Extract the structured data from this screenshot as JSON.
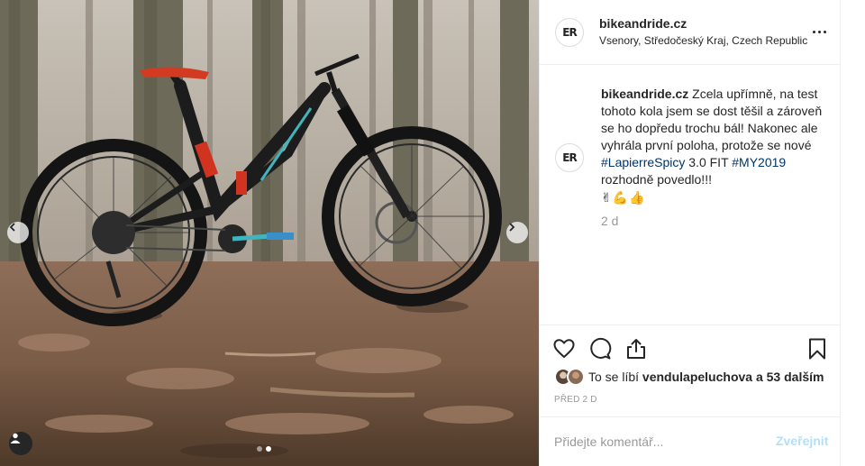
{
  "post": {
    "account": {
      "username": "bikeandride.cz",
      "location": "Vsenory, Středočeský Kraj, Czech Republic",
      "avatar_initials": "ER"
    },
    "caption": {
      "username": "bikeandride.cz",
      "text_1": " Zcela upřímně, na test tohoto kola jsem se dost těšil a zároveň se ho dopředu trochu bál! Nakonec ale vyhrála první poloha, protože se nové ",
      "hashtag_1": "#LapierreSpicy",
      "text_2": " 3.0 FIT ",
      "hashtag_2": "#MY2019",
      "text_3": " rozhodně povedlo!!!",
      "emojis": [
        "✌",
        "💪",
        "👍"
      ],
      "time_ago": "2 d"
    },
    "likes": {
      "prefix": "To se líbí ",
      "liker": "vendulapeluchova",
      "suffix": " a 53 dalším"
    },
    "posted_date": "PŘED 2 D",
    "comment": {
      "placeholder": "Přidejte komentář...",
      "publish_label": "Zveřejnit"
    }
  },
  "carousel": {
    "total": 2,
    "current": 1
  },
  "colors": {
    "link": "#003569",
    "muted": "#999999",
    "publish_disabled": "#b2dffc",
    "border": "#efefef"
  },
  "icons": {
    "prev": "chevron-left-icon",
    "next": "chevron-right-icon",
    "tags": "user-tag-icon",
    "more": "more-options-icon",
    "like": "heart-icon",
    "comment": "comment-bubble-icon",
    "share": "share-icon",
    "save": "bookmark-icon"
  }
}
